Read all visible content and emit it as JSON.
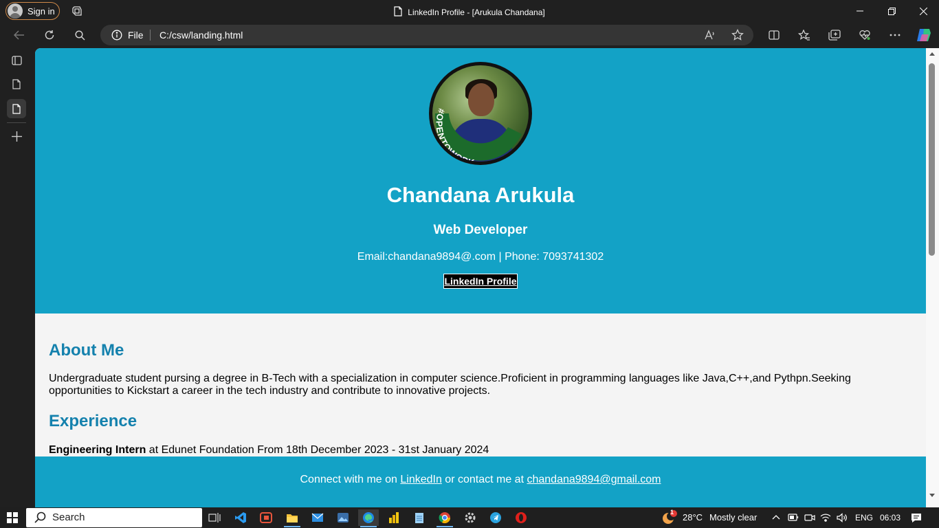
{
  "window": {
    "title": "LinkedIn Profile - [Arukula Chandana]",
    "sign_in_label": "Sign in"
  },
  "address_bar": {
    "scheme_label": "File",
    "url": "C:/csw/landing.html"
  },
  "page": {
    "name": "Chandana Arukula",
    "role": "Web Developer",
    "contact_line": "Email:chandana9894@.com | Phone: 7093741302",
    "linkedin_button": "LinkedIn Profile",
    "photo_badge": "#OPENTOWORK",
    "about_heading": "About Me",
    "about_text": "Undergraduate student pursing a degree in B-Tech with a specialization in computer science.Proficient in programming languages like Java,C++,and Pythpn.Seeking opportunities to Kickstart a career in the tech industry and contribute to innovative projects.",
    "experience_heading": "Experience",
    "experience": {
      "title": "Engineering Intern",
      "rest": " at Edunet Foundation From 18th December 2023 - 31st January 2024"
    },
    "footer": {
      "prefix": "Connect with me on ",
      "link1": "LinkedIn",
      "middle": " or contact me at ",
      "link2": "chandana9894@gmail.com"
    }
  },
  "taskbar": {
    "search_label": "Search",
    "weather_temp": "28°C",
    "weather_desc": "Mostly clear",
    "weather_badge": "1",
    "language": "ENG",
    "clock": "06:03"
  },
  "colors": {
    "header_bg": "#13a2c6",
    "heading_blue": "#1481ad",
    "body_bg": "#f4f4f4"
  }
}
